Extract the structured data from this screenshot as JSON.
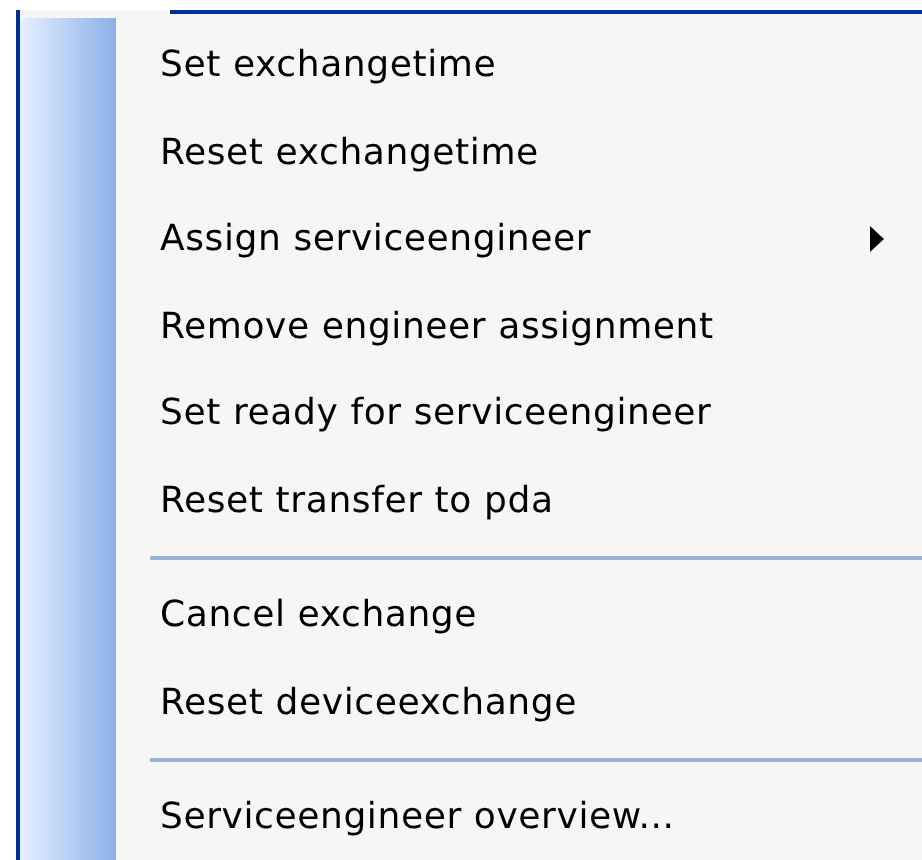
{
  "context_menu": {
    "items": [
      {
        "kind": "item",
        "label": "Set exchangetime",
        "has_submenu": false
      },
      {
        "kind": "item",
        "label": "Reset exchangetime",
        "has_submenu": false
      },
      {
        "kind": "item",
        "label": "Assign serviceengineer",
        "has_submenu": true
      },
      {
        "kind": "item",
        "label": "Remove engineer assignment",
        "has_submenu": false
      },
      {
        "kind": "item",
        "label": "Set ready for serviceengineer",
        "has_submenu": false
      },
      {
        "kind": "item",
        "label": "Reset transfer to pda",
        "has_submenu": false
      },
      {
        "kind": "separator"
      },
      {
        "kind": "item",
        "label": "Cancel exchange",
        "has_submenu": false
      },
      {
        "kind": "item",
        "label": "Reset deviceexchange",
        "has_submenu": false
      },
      {
        "kind": "separator"
      },
      {
        "kind": "item",
        "label": "Serviceengineer overview...",
        "has_submenu": false
      }
    ]
  }
}
